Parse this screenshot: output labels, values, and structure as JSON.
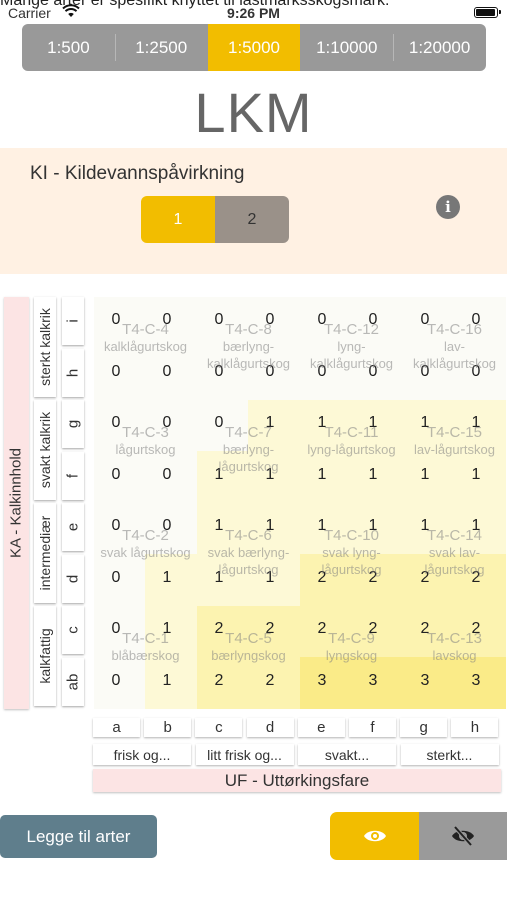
{
  "banner": "Mange arter er spesifikt knyttet til lastmarksskogsmark.",
  "statusbar": {
    "carrier": "Carrier",
    "time": "9:26 PM"
  },
  "scales": [
    {
      "label": "1:500",
      "active": false
    },
    {
      "label": "1:2500",
      "active": false
    },
    {
      "label": "1:5000",
      "active": true
    },
    {
      "label": "1:10000",
      "active": false
    },
    {
      "label": "1:20000",
      "active": false
    }
  ],
  "title": "LKM",
  "ki": {
    "label": "KI - Kildevannspåvirkning",
    "options": [
      "1",
      "2"
    ],
    "active": 0,
    "info_icon": "info-icon"
  },
  "ka": {
    "label": "KA - Kalkinnhold",
    "groups": [
      "sterkt kalkrik",
      "svakt kalkrik",
      "intermediær",
      "kalkfattig"
    ],
    "steps": [
      "i",
      "h",
      "g",
      "f",
      "e",
      "d",
      "c",
      "ab"
    ]
  },
  "grid": {
    "rows": [
      {
        "codes": [
          "T4-C-4",
          "T4-C-8",
          "T4-C-12",
          "T4-C-16"
        ],
        "names": [
          "kalklågurtskog",
          "bærlyng-kalklågurtskog",
          "lyng-kalklågurtskog",
          "lav-kalklågurtskog"
        ],
        "top": [
          0,
          0,
          0,
          0,
          0,
          0,
          0,
          0
        ],
        "bottom": [
          0,
          0,
          0,
          0,
          0,
          0,
          0,
          0
        ]
      },
      {
        "codes": [
          "T4-C-3",
          "T4-C-7",
          "T4-C-11",
          "T4-C-15"
        ],
        "names": [
          "lågurtskog",
          "bærlyng-lågurtskog",
          "lyng-lågurtskog",
          "lav-lågurtskog"
        ],
        "top": [
          0,
          0,
          0,
          1,
          1,
          1,
          1,
          1
        ],
        "bottom": [
          0,
          0,
          1,
          1,
          1,
          1,
          1,
          1
        ]
      },
      {
        "codes": [
          "T4-C-2",
          "T4-C-6",
          "T4-C-10",
          "T4-C-14"
        ],
        "names": [
          "svak lågurtskog",
          "svak bærlyng-lågurtskog",
          "svak lyng-lågurtskog",
          "svak lav-lågurtskog"
        ],
        "top": [
          0,
          0,
          1,
          1,
          1,
          1,
          1,
          1
        ],
        "bottom": [
          0,
          1,
          1,
          1,
          2,
          2,
          2,
          2
        ]
      },
      {
        "codes": [
          "T4-C-1",
          "T4-C-5",
          "T4-C-9",
          "T4-C-13"
        ],
        "names": [
          "blåbærskog",
          "bærlyngskog",
          "lyngskog",
          "lavskog"
        ],
        "top": [
          0,
          1,
          2,
          2,
          2,
          2,
          2,
          2
        ],
        "bottom": [
          0,
          1,
          2,
          2,
          3,
          3,
          3,
          3
        ]
      }
    ],
    "colors": {
      "0": "#FBFBF6",
      "1": "#FDF9D6",
      "2": "#FCF3B0",
      "3": "#FAEB88"
    }
  },
  "uf": {
    "steps": [
      "a",
      "b",
      "c",
      "d",
      "e",
      "f",
      "g",
      "h"
    ],
    "groups": [
      "frisk og...",
      "litt frisk og...",
      "svakt...",
      "sterkt..."
    ],
    "label": "UF - Uttørkingsfare"
  },
  "add_button": "Legge til arter",
  "visibility": {
    "on_icon": "eye-icon",
    "off_icon": "eye-off-icon"
  }
}
